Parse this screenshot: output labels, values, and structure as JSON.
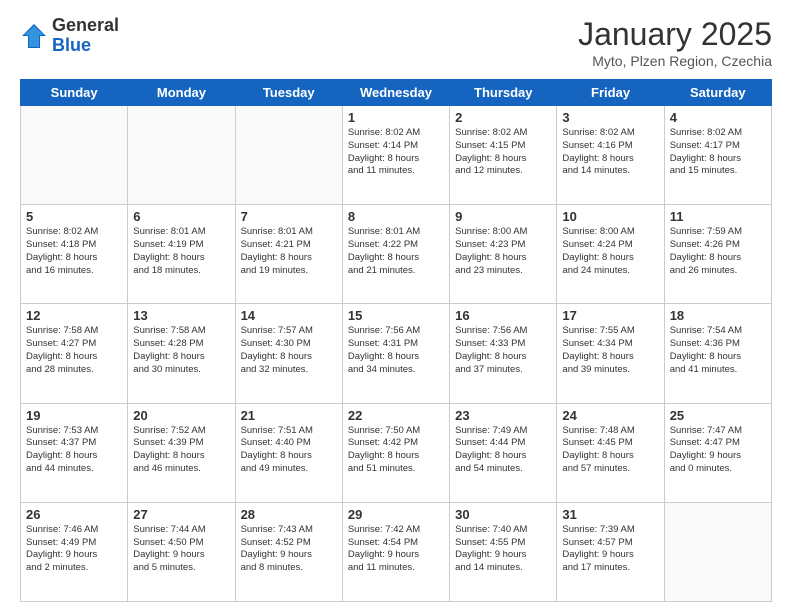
{
  "header": {
    "logo_general": "General",
    "logo_blue": "Blue",
    "month_title": "January 2025",
    "location": "Myto, Plzen Region, Czechia"
  },
  "days_of_week": [
    "Sunday",
    "Monday",
    "Tuesday",
    "Wednesday",
    "Thursday",
    "Friday",
    "Saturday"
  ],
  "weeks": [
    [
      {
        "day": "",
        "info": ""
      },
      {
        "day": "",
        "info": ""
      },
      {
        "day": "",
        "info": ""
      },
      {
        "day": "1",
        "info": "Sunrise: 8:02 AM\nSunset: 4:14 PM\nDaylight: 8 hours\nand 11 minutes."
      },
      {
        "day": "2",
        "info": "Sunrise: 8:02 AM\nSunset: 4:15 PM\nDaylight: 8 hours\nand 12 minutes."
      },
      {
        "day": "3",
        "info": "Sunrise: 8:02 AM\nSunset: 4:16 PM\nDaylight: 8 hours\nand 14 minutes."
      },
      {
        "day": "4",
        "info": "Sunrise: 8:02 AM\nSunset: 4:17 PM\nDaylight: 8 hours\nand 15 minutes."
      }
    ],
    [
      {
        "day": "5",
        "info": "Sunrise: 8:02 AM\nSunset: 4:18 PM\nDaylight: 8 hours\nand 16 minutes."
      },
      {
        "day": "6",
        "info": "Sunrise: 8:01 AM\nSunset: 4:19 PM\nDaylight: 8 hours\nand 18 minutes."
      },
      {
        "day": "7",
        "info": "Sunrise: 8:01 AM\nSunset: 4:21 PM\nDaylight: 8 hours\nand 19 minutes."
      },
      {
        "day": "8",
        "info": "Sunrise: 8:01 AM\nSunset: 4:22 PM\nDaylight: 8 hours\nand 21 minutes."
      },
      {
        "day": "9",
        "info": "Sunrise: 8:00 AM\nSunset: 4:23 PM\nDaylight: 8 hours\nand 23 minutes."
      },
      {
        "day": "10",
        "info": "Sunrise: 8:00 AM\nSunset: 4:24 PM\nDaylight: 8 hours\nand 24 minutes."
      },
      {
        "day": "11",
        "info": "Sunrise: 7:59 AM\nSunset: 4:26 PM\nDaylight: 8 hours\nand 26 minutes."
      }
    ],
    [
      {
        "day": "12",
        "info": "Sunrise: 7:58 AM\nSunset: 4:27 PM\nDaylight: 8 hours\nand 28 minutes."
      },
      {
        "day": "13",
        "info": "Sunrise: 7:58 AM\nSunset: 4:28 PM\nDaylight: 8 hours\nand 30 minutes."
      },
      {
        "day": "14",
        "info": "Sunrise: 7:57 AM\nSunset: 4:30 PM\nDaylight: 8 hours\nand 32 minutes."
      },
      {
        "day": "15",
        "info": "Sunrise: 7:56 AM\nSunset: 4:31 PM\nDaylight: 8 hours\nand 34 minutes."
      },
      {
        "day": "16",
        "info": "Sunrise: 7:56 AM\nSunset: 4:33 PM\nDaylight: 8 hours\nand 37 minutes."
      },
      {
        "day": "17",
        "info": "Sunrise: 7:55 AM\nSunset: 4:34 PM\nDaylight: 8 hours\nand 39 minutes."
      },
      {
        "day": "18",
        "info": "Sunrise: 7:54 AM\nSunset: 4:36 PM\nDaylight: 8 hours\nand 41 minutes."
      }
    ],
    [
      {
        "day": "19",
        "info": "Sunrise: 7:53 AM\nSunset: 4:37 PM\nDaylight: 8 hours\nand 44 minutes."
      },
      {
        "day": "20",
        "info": "Sunrise: 7:52 AM\nSunset: 4:39 PM\nDaylight: 8 hours\nand 46 minutes."
      },
      {
        "day": "21",
        "info": "Sunrise: 7:51 AM\nSunset: 4:40 PM\nDaylight: 8 hours\nand 49 minutes."
      },
      {
        "day": "22",
        "info": "Sunrise: 7:50 AM\nSunset: 4:42 PM\nDaylight: 8 hours\nand 51 minutes."
      },
      {
        "day": "23",
        "info": "Sunrise: 7:49 AM\nSunset: 4:44 PM\nDaylight: 8 hours\nand 54 minutes."
      },
      {
        "day": "24",
        "info": "Sunrise: 7:48 AM\nSunset: 4:45 PM\nDaylight: 8 hours\nand 57 minutes."
      },
      {
        "day": "25",
        "info": "Sunrise: 7:47 AM\nSunset: 4:47 PM\nDaylight: 9 hours\nand 0 minutes."
      }
    ],
    [
      {
        "day": "26",
        "info": "Sunrise: 7:46 AM\nSunset: 4:49 PM\nDaylight: 9 hours\nand 2 minutes."
      },
      {
        "day": "27",
        "info": "Sunrise: 7:44 AM\nSunset: 4:50 PM\nDaylight: 9 hours\nand 5 minutes."
      },
      {
        "day": "28",
        "info": "Sunrise: 7:43 AM\nSunset: 4:52 PM\nDaylight: 9 hours\nand 8 minutes."
      },
      {
        "day": "29",
        "info": "Sunrise: 7:42 AM\nSunset: 4:54 PM\nDaylight: 9 hours\nand 11 minutes."
      },
      {
        "day": "30",
        "info": "Sunrise: 7:40 AM\nSunset: 4:55 PM\nDaylight: 9 hours\nand 14 minutes."
      },
      {
        "day": "31",
        "info": "Sunrise: 7:39 AM\nSunset: 4:57 PM\nDaylight: 9 hours\nand 17 minutes."
      },
      {
        "day": "",
        "info": ""
      }
    ]
  ]
}
